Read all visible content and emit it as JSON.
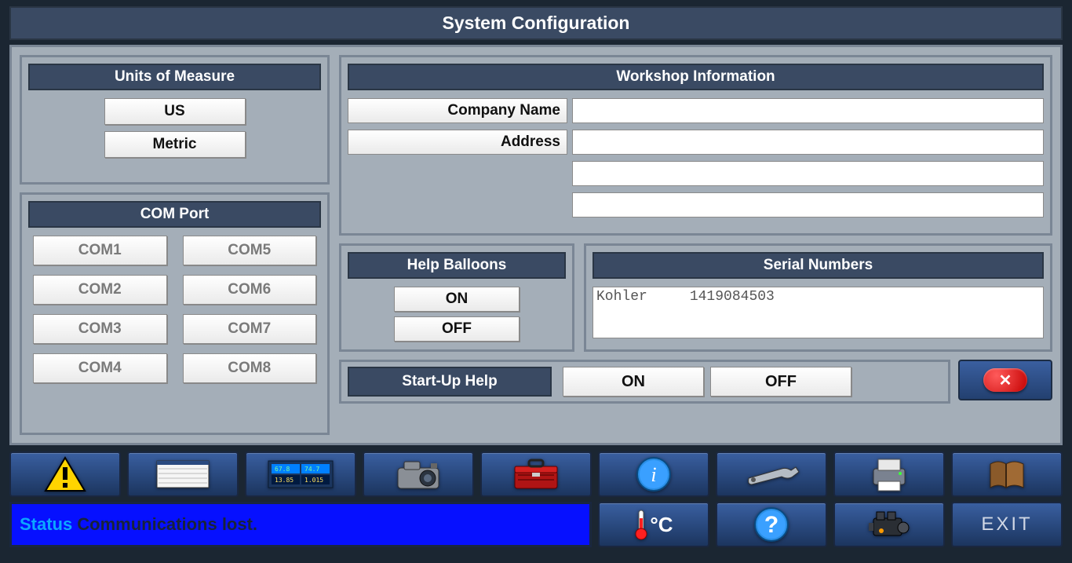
{
  "title": "System Configuration",
  "units": {
    "header": "Units of Measure",
    "us": "US",
    "metric": "Metric"
  },
  "com": {
    "header": "COM Port",
    "ports": [
      "COM1",
      "COM2",
      "COM3",
      "COM4",
      "COM5",
      "COM6",
      "COM7",
      "COM8"
    ]
  },
  "workshop": {
    "header": "Workshop Information",
    "company_label": "Company Name",
    "address_label": "Address",
    "company": "",
    "addr1": "",
    "addr2": "",
    "addr3": ""
  },
  "help": {
    "header": "Help Balloons",
    "on": "ON",
    "off": "OFF"
  },
  "serial": {
    "header": "Serial Numbers",
    "rows": [
      [
        "Kohler",
        "1419084503"
      ]
    ]
  },
  "startup": {
    "header": "Start-Up Help",
    "on": "ON",
    "off": "OFF"
  },
  "status": {
    "label": "Status",
    "msg": "Communications lost."
  },
  "exit": "EXIT",
  "temp_unit": "°C"
}
